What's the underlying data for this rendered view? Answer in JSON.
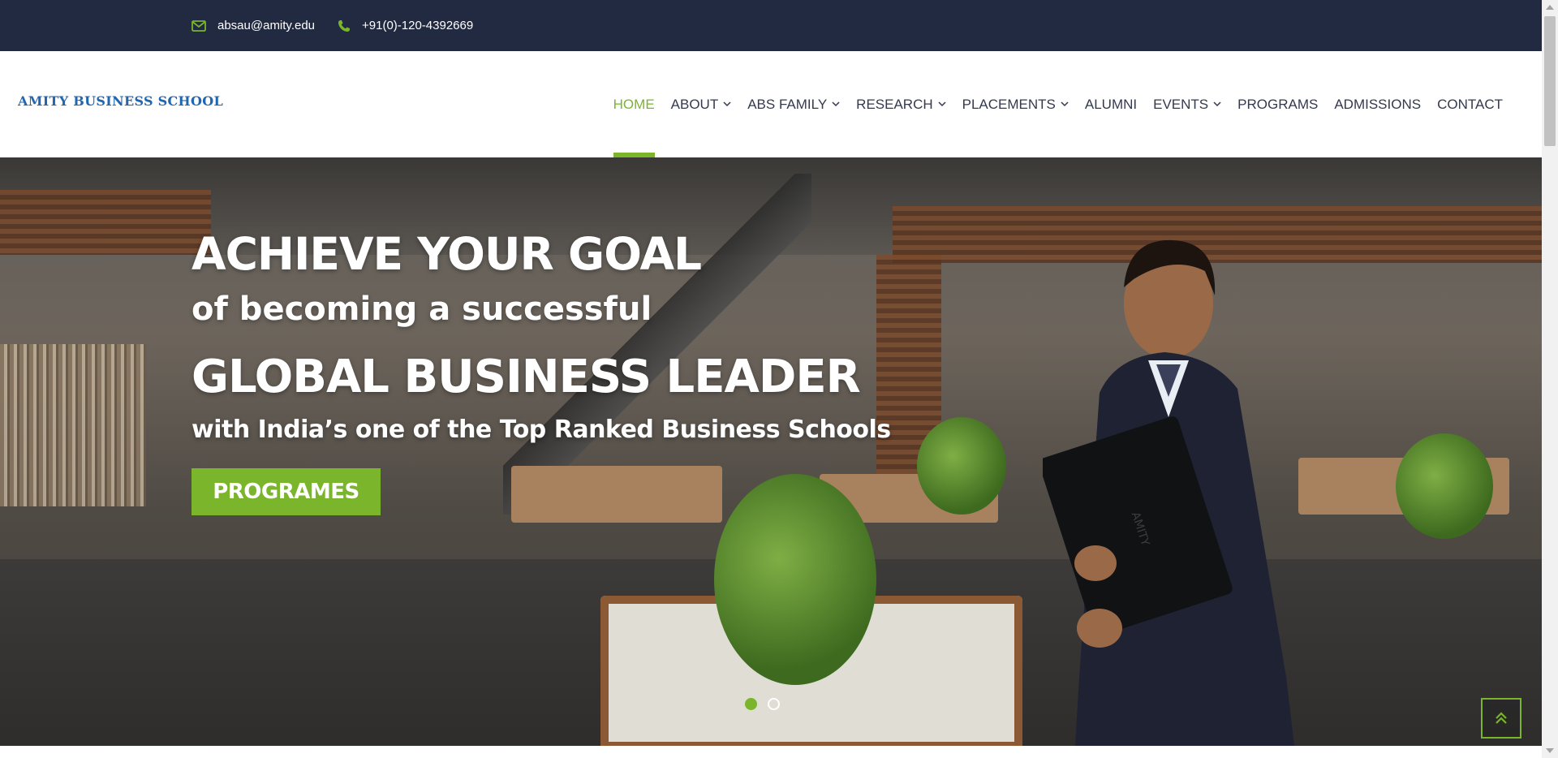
{
  "topbar": {
    "email": "absau@amity.edu",
    "phone": "+91(0)-120-4392669",
    "email_icon": "envelope-icon",
    "phone_icon": "phone-icon"
  },
  "header": {
    "logo_text": "AMITY BUSINESS SCHOOL",
    "nav": [
      {
        "label": "HOME",
        "active": true,
        "dropdown": false
      },
      {
        "label": "ABOUT",
        "active": false,
        "dropdown": true
      },
      {
        "label": "ABS FAMILY",
        "active": false,
        "dropdown": true
      },
      {
        "label": "RESEARCH",
        "active": false,
        "dropdown": true
      },
      {
        "label": "PLACEMENTS",
        "active": false,
        "dropdown": true
      },
      {
        "label": "ALUMNI",
        "active": false,
        "dropdown": false
      },
      {
        "label": "EVENTS",
        "active": false,
        "dropdown": true
      },
      {
        "label": "PROGRAMS",
        "active": false,
        "dropdown": false
      },
      {
        "label": "ADMISSIONS",
        "active": false,
        "dropdown": false
      },
      {
        "label": "CONTACT",
        "active": false,
        "dropdown": false
      }
    ]
  },
  "hero": {
    "line1": "ACHIEVE YOUR GOAL",
    "line2": "of becoming a successful",
    "line3": "GLOBAL BUSINESS LEADER",
    "line4": "with India’s one of the Top Ranked Business Schools",
    "cta_label": "PROGRAMES",
    "slides": 2,
    "active_slide": 1,
    "laptop_text": "AMITY"
  },
  "colors": {
    "accent": "#7ab52c",
    "topbar_bg": "#222a41",
    "logo": "#2166b0",
    "nav_text": "#333a4d"
  },
  "scroll_to_top_icon": "double-chevron-up-icon"
}
